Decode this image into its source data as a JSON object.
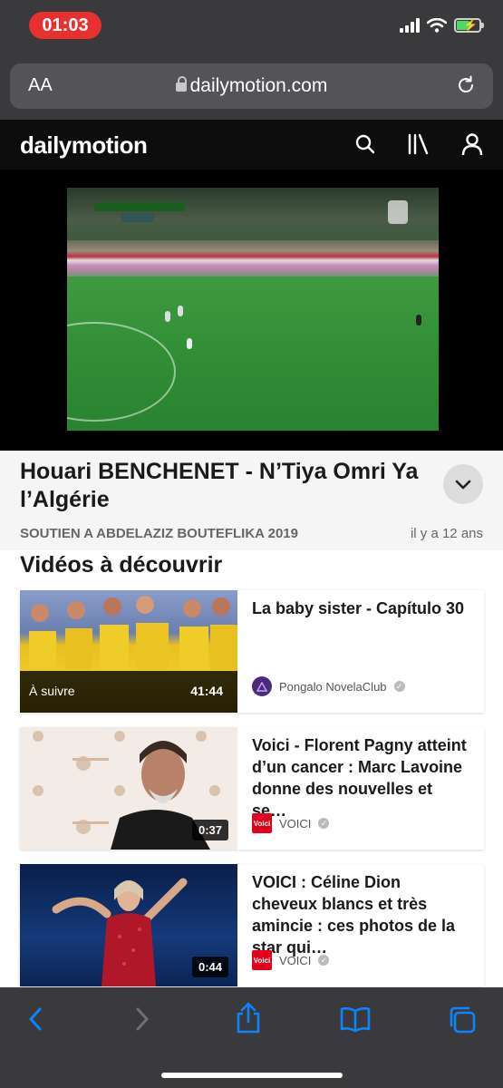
{
  "status_bar": {
    "time": "01:03"
  },
  "browser": {
    "text_size_label": "AA",
    "url": "dailymotion.com"
  },
  "site": {
    "logo": "dailymotion"
  },
  "video": {
    "title": "Houari BENCHENET - N’Tiya Omri Ya l’Algérie",
    "channel": "SOUTIEN A ABDELAZIZ BOUTEFLIKA 2019",
    "age": "il y a 12 ans"
  },
  "discover": {
    "heading": "Vidéos à découvrir",
    "items": [
      {
        "title": "La baby sister - Capítulo 30",
        "channel": "Pongalo NovelaClub",
        "badge": "À suivre",
        "duration": "41:44"
      },
      {
        "title": "Voici - Florent Pagny atteint d’un cancer : Marc Lavoine donne des nouvelles et se…",
        "channel": "VOICI",
        "duration": "0:37"
      },
      {
        "title": "VOICI : Céline Dion cheveux blancs et très amincie : ces photos de la star qui…",
        "channel": "VOICI",
        "duration": "0:44"
      }
    ]
  },
  "colors": {
    "accent": "#0a84ff",
    "time_pill": "#e8312f",
    "header_bg": "#0d0d0d"
  }
}
